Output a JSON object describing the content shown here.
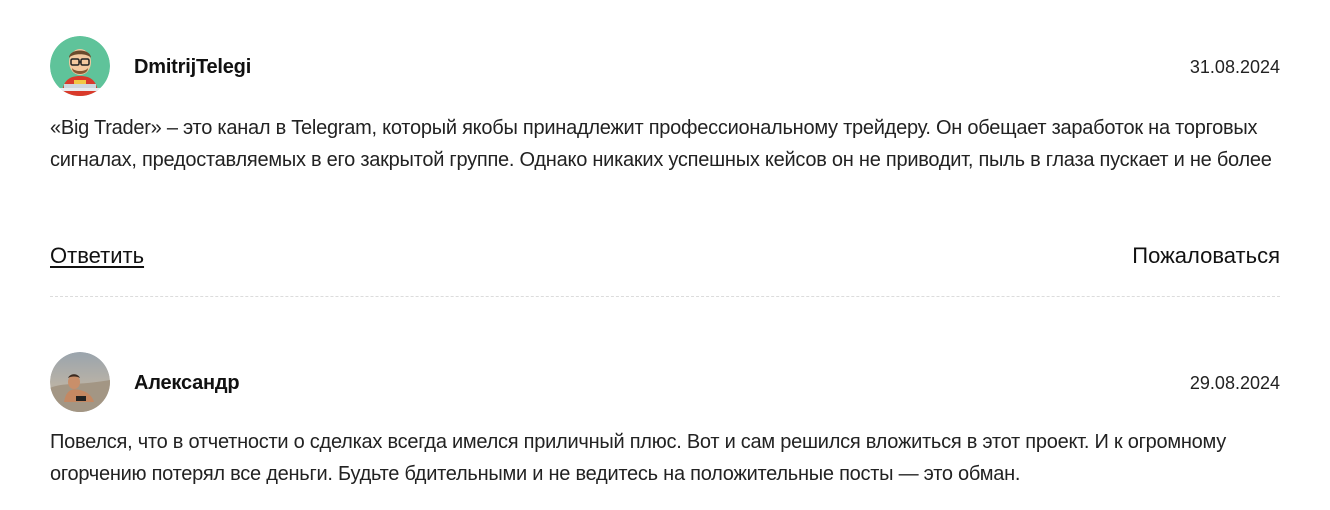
{
  "comments": [
    {
      "author": "DmitrijTelegi",
      "date": "31.08.2024",
      "text": "«Big Trader» – это канал в Telegram, который якобы принадлежит профессиональному трейдеру. Он обещает заработок на торговых сигналах, предоставляемых в его закрытой группе. Однако никаких успешных кейсов он не приводит, пыль в глаза пускает и не более",
      "reply_label": "Ответить",
      "report_label": "Пожаловаться"
    },
    {
      "author": "Александр",
      "date": "29.08.2024",
      "text": "Повелся, что в отчетности о сделках всегда имелся приличный плюс. Вот и сам решился вложиться в этот проект. И к огромному огорчению потерял все деньги. Будьте бдительными и не ведитесь на положительные посты — это обман."
    }
  ],
  "colors": {
    "avatar_bg_green": "#5fc39a",
    "text": "#222222",
    "divider": "#dcdcdc"
  }
}
